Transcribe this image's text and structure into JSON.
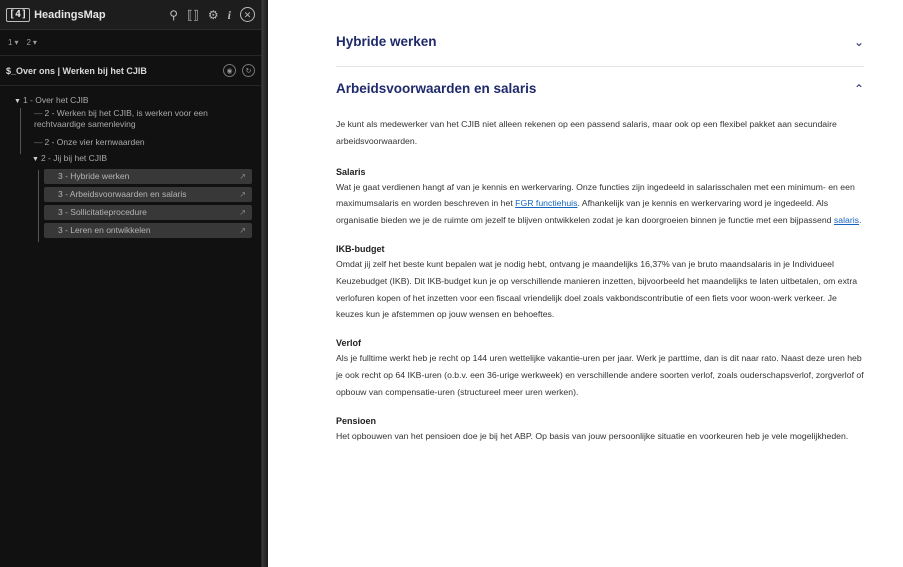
{
  "headingsmap": {
    "logo": "[4]",
    "title": "HeadingsMap",
    "tools": {
      "pin": "⚲",
      "brackets": "⟦⟧",
      "settings": "⚙",
      "info": "i",
      "close": "✕"
    },
    "level_selects": [
      {
        "label": "1",
        "chevron": "▾"
      },
      {
        "label": "2",
        "chevron": "▾"
      }
    ],
    "document_title": "$_Over ons | Werken bij het CJIB",
    "tree": [
      {
        "label": "1 - Over het CJIB",
        "level": 1,
        "toggle": "▼"
      },
      {
        "label": "2 - Werken bij het CJIB, is werken voor een rechtvaardige samenleving",
        "level": 2
      },
      {
        "label": "2 - Onze vier kernwaarden",
        "level": 2
      },
      {
        "label": "2 - Jij bij het CJIB",
        "level": 2,
        "toggle": "▼"
      },
      {
        "label": "3 - Hybride werken",
        "level": 3
      },
      {
        "label": "3 - Arbeidsvoorwaarden en salaris",
        "level": 3
      },
      {
        "label": "3 - Sollicitatieprocedure",
        "level": 3
      },
      {
        "label": "3 - Leren en ontwikkelen",
        "level": 3
      }
    ]
  },
  "content": {
    "sections": [
      {
        "title": "Hybride werken",
        "expanded": false,
        "chevron": "⌄"
      },
      {
        "title": "Arbeidsvoorwaarden en salaris",
        "expanded": true,
        "chevron": "⌃"
      }
    ],
    "intro": "Je kunt als medewerker van het CJIB niet alleen rekenen op een passend salaris, maar ook op een flexibel pakket aan secundaire arbeidsvoorwaarden.",
    "salaris": {
      "heading": "Salaris",
      "text_before": "Wat je gaat verdienen hangt af van je kennis en werkervaring. Onze functies zijn ingedeeld in salarisschalen met een minimum- en een maximumsalaris en worden beschreven in het ",
      "link1": "FGR functiehuis",
      "text_middle": ". Afhankelijk van je kennis en werkervaring word je ingedeeld. Als organisatie bieden we je de ruimte om jezelf te blijven ontwikkelen zodat je kan doorgroeien binnen je functie met een bijpassend ",
      "link2": "salaris",
      "text_after": "."
    },
    "ikb": {
      "heading": "IKB-budget",
      "text": "Omdat jij zelf het beste kunt bepalen wat je nodig hebt, ontvang je maandelijks 16,37% van je bruto maandsalaris in je Individueel Keuzebudget (IKB). Dit IKB-budget kun je op verschillende manieren inzetten, bijvoorbeeld het maandelijks te laten uitbetalen, om extra verlofuren kopen of het inzetten voor een fiscaal vriendelijk doel zoals vakbondscontributie of een fiets voor woon-werk verkeer. Je keuzes kun je afstemmen op jouw wensen en behoeftes."
    },
    "verlof": {
      "heading": "Verlof",
      "text": "Als je fulltime werkt heb je recht op 144 uren wettelijke vakantie-uren per jaar. Werk je parttime, dan is dit naar rato. Naast deze uren heb je ook recht op 64 IKB-uren (o.b.v. een 36-urige werkweek) en verschillende andere soorten verlof, zoals ouderschapsverlof, zorgverlof of opbouw van compensatie-uren (structureel meer uren werken)."
    },
    "pensioen": {
      "heading": "Pensioen",
      "text": "Het opbouwen van het pensioen doe je bij het ABP. Op basis van jouw persoonlijke situatie en voorkeuren heb je vele mogelijkheden."
    }
  },
  "colors": {
    "panel_bg": "#111111",
    "heading_blue": "#1f2a6b",
    "link_blue": "#1565c0",
    "body_text": "#333333"
  }
}
